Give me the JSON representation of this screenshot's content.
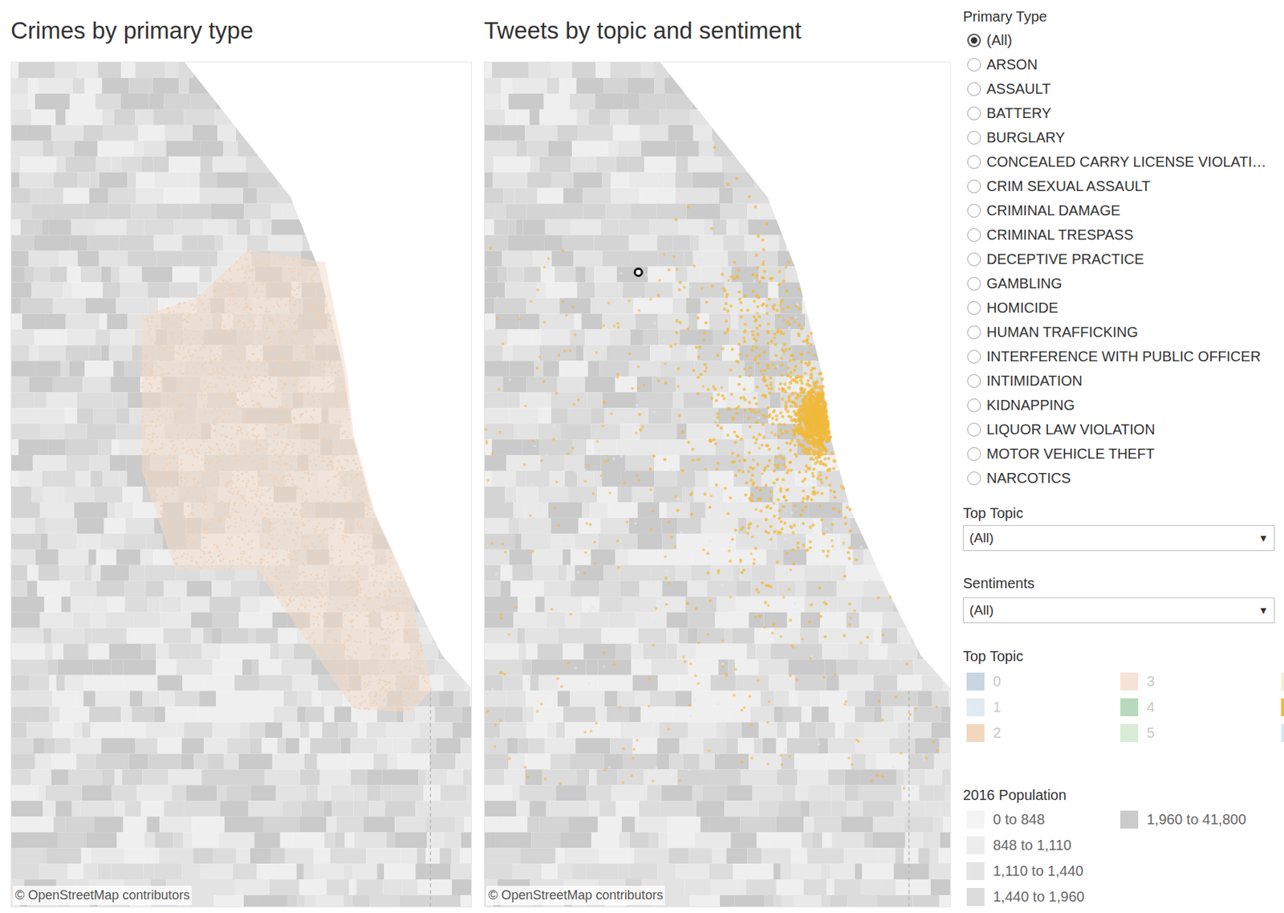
{
  "maps": [
    {
      "title": "Crimes by primary type",
      "attribution": "© OpenStreetMap contributors",
      "kind": "crimes"
    },
    {
      "title": "Tweets by topic and sentiment",
      "attribution": "© OpenStreetMap contributors",
      "kind": "tweets"
    }
  ],
  "primary_type": {
    "label": "Primary Type",
    "options": [
      {
        "label": "(All)",
        "selected": true
      },
      {
        "label": "ARSON",
        "selected": false
      },
      {
        "label": "ASSAULT",
        "selected": false
      },
      {
        "label": "BATTERY",
        "selected": false
      },
      {
        "label": "BURGLARY",
        "selected": false
      },
      {
        "label": "CONCEALED CARRY LICENSE VIOLATI…",
        "selected": false
      },
      {
        "label": "CRIM SEXUAL ASSAULT",
        "selected": false
      },
      {
        "label": "CRIMINAL DAMAGE",
        "selected": false
      },
      {
        "label": "CRIMINAL TRESPASS",
        "selected": false
      },
      {
        "label": "DECEPTIVE PRACTICE",
        "selected": false
      },
      {
        "label": "GAMBLING",
        "selected": false
      },
      {
        "label": "HOMICIDE",
        "selected": false
      },
      {
        "label": "HUMAN TRAFFICKING",
        "selected": false
      },
      {
        "label": "INTERFERENCE WITH PUBLIC OFFICER",
        "selected": false
      },
      {
        "label": "INTIMIDATION",
        "selected": false
      },
      {
        "label": "KIDNAPPING",
        "selected": false
      },
      {
        "label": "LIQUOR LAW VIOLATION",
        "selected": false
      },
      {
        "label": "MOTOR VEHICLE THEFT",
        "selected": false
      },
      {
        "label": "NARCOTICS",
        "selected": false
      }
    ]
  },
  "filters": [
    {
      "label": "Top Topic",
      "value": "(All)",
      "arrow": "▼"
    },
    {
      "label": "Sentiments",
      "value": "(All)",
      "arrow": "▼"
    }
  ],
  "topic_legend": {
    "title": "Top Topic",
    "items": [
      {
        "label": "0",
        "color": "#c9d5e2"
      },
      {
        "label": "1",
        "color": "#e2eaf1"
      },
      {
        "label": "2",
        "color": "#f1d7bd"
      },
      {
        "label": "3",
        "color": "#f6e3d8"
      },
      {
        "label": "4",
        "color": "#b8d9bc"
      },
      {
        "label": "5",
        "color": "#d9ecd6"
      },
      {
        "label": "",
        "color": "#f3efd6"
      },
      {
        "label": "",
        "color": "#f0b93c"
      },
      {
        "label": "",
        "color": "#dbe8ee"
      }
    ]
  },
  "population_legend": {
    "title": "2016 Population",
    "items": [
      {
        "label": "0 to 848",
        "color": "#f4f4f4"
      },
      {
        "label": "848 to 1,110",
        "color": "#ededed"
      },
      {
        "label": "1,110 to 1,440",
        "color": "#e5e5e5"
      },
      {
        "label": "1,440 to 1,960",
        "color": "#dcdcdc"
      },
      {
        "label": "1,960 to 41,800",
        "color": "#cbcbcb"
      }
    ]
  }
}
